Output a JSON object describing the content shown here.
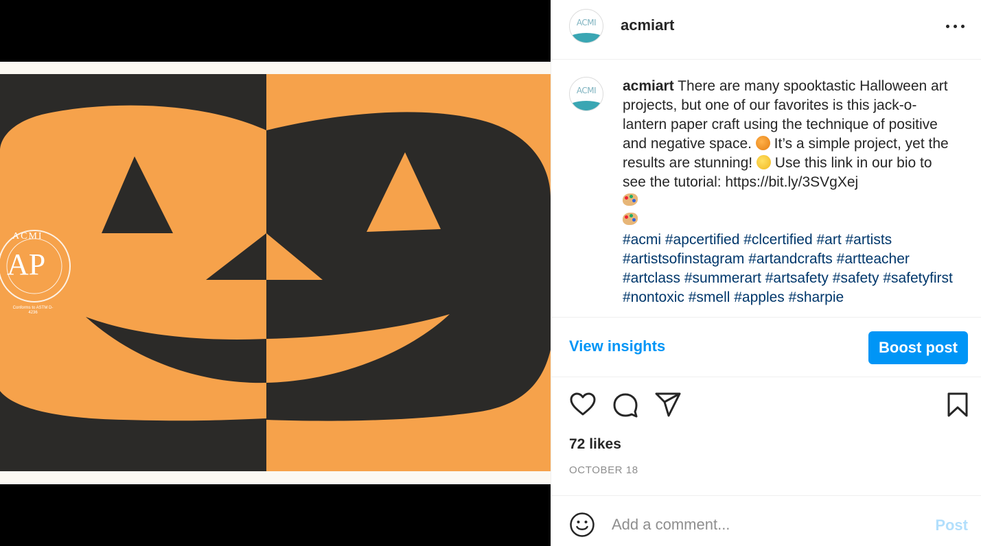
{
  "post": {
    "username": "acmiart",
    "avatar_text": "ACMI",
    "more_icon": "more-horizontal-icon",
    "image": {
      "description_icon": "jack-o-lantern-image",
      "watermark": {
        "top_text": "ACMI",
        "mark": "AP",
        "small_text": "Conforms to ASTM D-4236"
      },
      "colors": {
        "orange": "#f6a24b",
        "black": "#2b2a28"
      }
    },
    "caption": {
      "username": "acmiart",
      "text_1": " There are many spooktastic Halloween art projects, but one of our favorites is this jack-o-lantern paper craft using the technique of positive and negative space. ",
      "text_2": " It’s a simple project, yet the results are stunning! ",
      "text_3": " Use this link in our bio to see the tutorial: https://bit.ly/3SVgXej",
      "hashtags": "#acmi #apcertified #clcertified #art #artists #artistsofinstagram #artandcrafts #artteacher #artclass #summerart #artsafety #safety #safetyfirst #nontoxic #smell #apples #sharpie"
    },
    "insights_label": "View insights",
    "boost_label": "Boost post",
    "icons": [
      "heart-icon",
      "comment-icon",
      "share-icon",
      "bookmark-icon"
    ],
    "likes": "72 likes",
    "date": "OCTOBER 18",
    "comment": {
      "placeholder": "Add a comment...",
      "value": "",
      "post_label": "Post"
    },
    "accent_color": "#0095f6"
  }
}
